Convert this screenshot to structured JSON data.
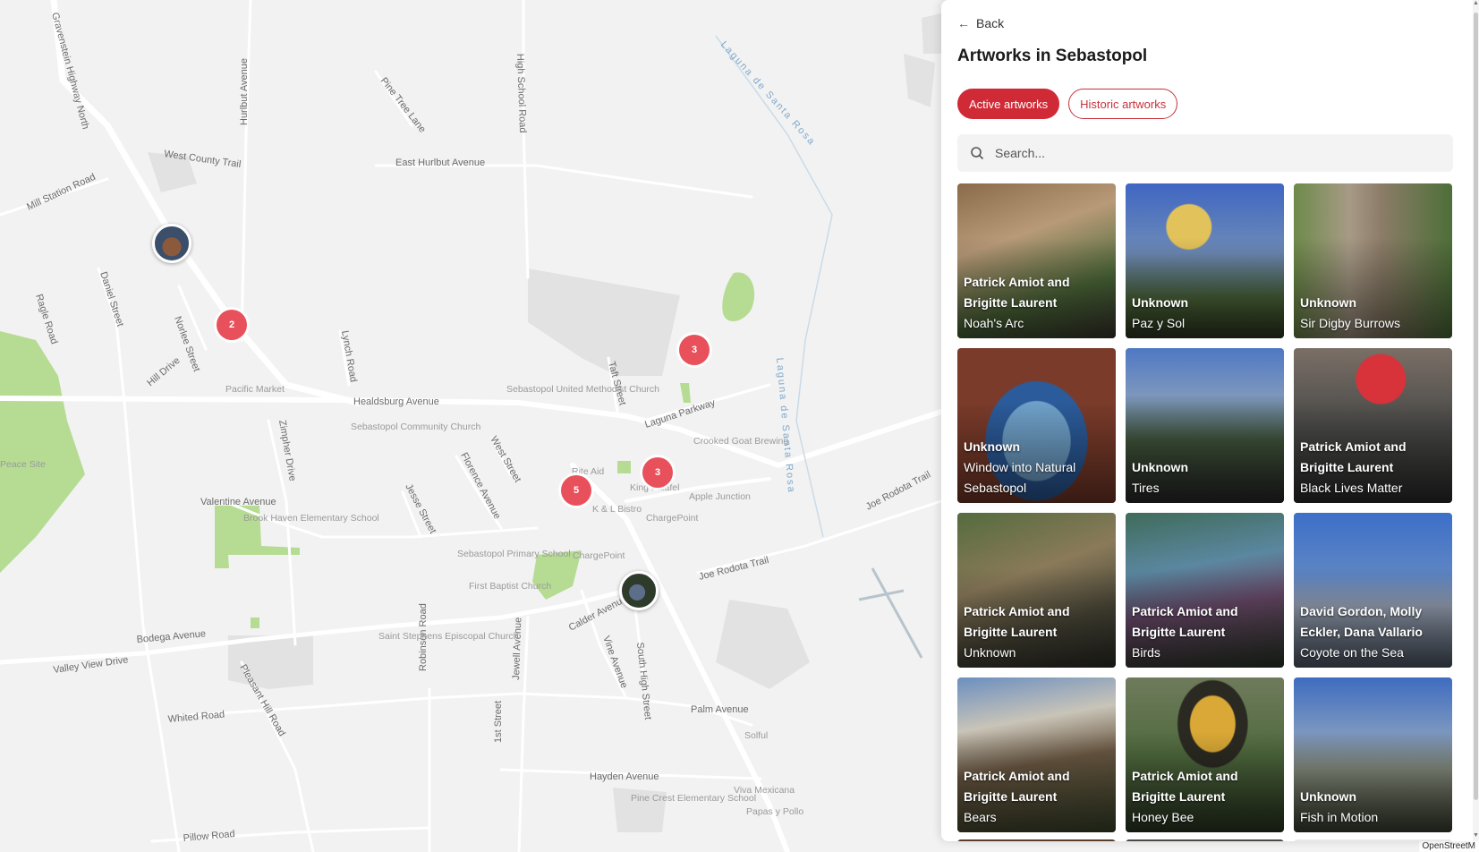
{
  "map": {
    "roads": [
      "Gravenstein Highway North",
      "Hurlbut Avenue",
      "High School Road",
      "Pine Tree Lane",
      "West County Trail",
      "East Hurlbut Avenue",
      "Mill Station Road",
      "Daniel Street",
      "Norlee Street",
      "Ragle Road",
      "Hill Drive",
      "Lynch Road",
      "Healdsburg Avenue",
      "Zimpher Drive",
      "Valentine Avenue",
      "Jesse Street",
      "Florence Avenue",
      "West Street",
      "Taft Street",
      "Laguna Parkway",
      "Joe Rodota Trail",
      "Bodega Avenue",
      "Valley View Drive",
      "Pleasant Hill Road",
      "Whited Road",
      "Robinson Road",
      "1st Street",
      "Jewell Avenue",
      "Calder Avenue",
      "Vine Avenue",
      "South High Street",
      "Palm Avenue",
      "Hayden Avenue",
      "Pillow Road"
    ],
    "places": [
      "Pacific Market",
      "Sebastopol United Methodist Church",
      "Sebastopol Community Church",
      "Crooked Goat Brewing",
      "Rite Aid",
      "King Falafel",
      "Apple Junction",
      "K & L Bistro",
      "ChargePoint",
      "Brook Haven Elementary School",
      "Sebastopol Primary School",
      "First Baptist Church",
      "Saint Stephens Episcopal Church",
      "Solful",
      "Viva Mexicana",
      "Pine Crest Elementary School",
      "Papas y Pollo",
      "Peace Site"
    ],
    "water": "Laguna de Santa Rosa",
    "clusters": [
      "2",
      "3",
      "3",
      "5"
    ],
    "attribution": "OpenStreetM"
  },
  "panel": {
    "back_label": "Back",
    "title": "Artworks in Sebastopol",
    "tabs": [
      "Active artworks",
      "Historic artworks"
    ],
    "active_tab": "Active artworks",
    "search_placeholder": "Search...",
    "accent_color": "#d02a36",
    "artworks": [
      {
        "artist": "Patrick Amiot and Brigitte Laurent",
        "title": "Noah's Arc"
      },
      {
        "artist": "Unknown",
        "title": "Paz y Sol"
      },
      {
        "artist": "Unknown",
        "title": "Sir Digby Burrows"
      },
      {
        "artist": "Unknown",
        "title": "Window into Natural Sebastopol"
      },
      {
        "artist": "Unknown",
        "title": "Tires"
      },
      {
        "artist": "Patrick Amiot and Brigitte Laurent",
        "title": "Black Lives Matter"
      },
      {
        "artist": "Patrick Amiot and Brigitte Laurent",
        "title": "Unknown"
      },
      {
        "artist": "Patrick Amiot and Brigitte Laurent",
        "title": "Birds"
      },
      {
        "artist": "David Gordon, Molly Eckler, Dana Vallario",
        "title": "Coyote on the Sea"
      },
      {
        "artist": "Patrick Amiot and Brigitte Laurent",
        "title": "Bears"
      },
      {
        "artist": "Patrick Amiot and Brigitte Laurent",
        "title": "Honey Bee"
      },
      {
        "artist": "Unknown",
        "title": "Fish in Motion"
      }
    ]
  }
}
